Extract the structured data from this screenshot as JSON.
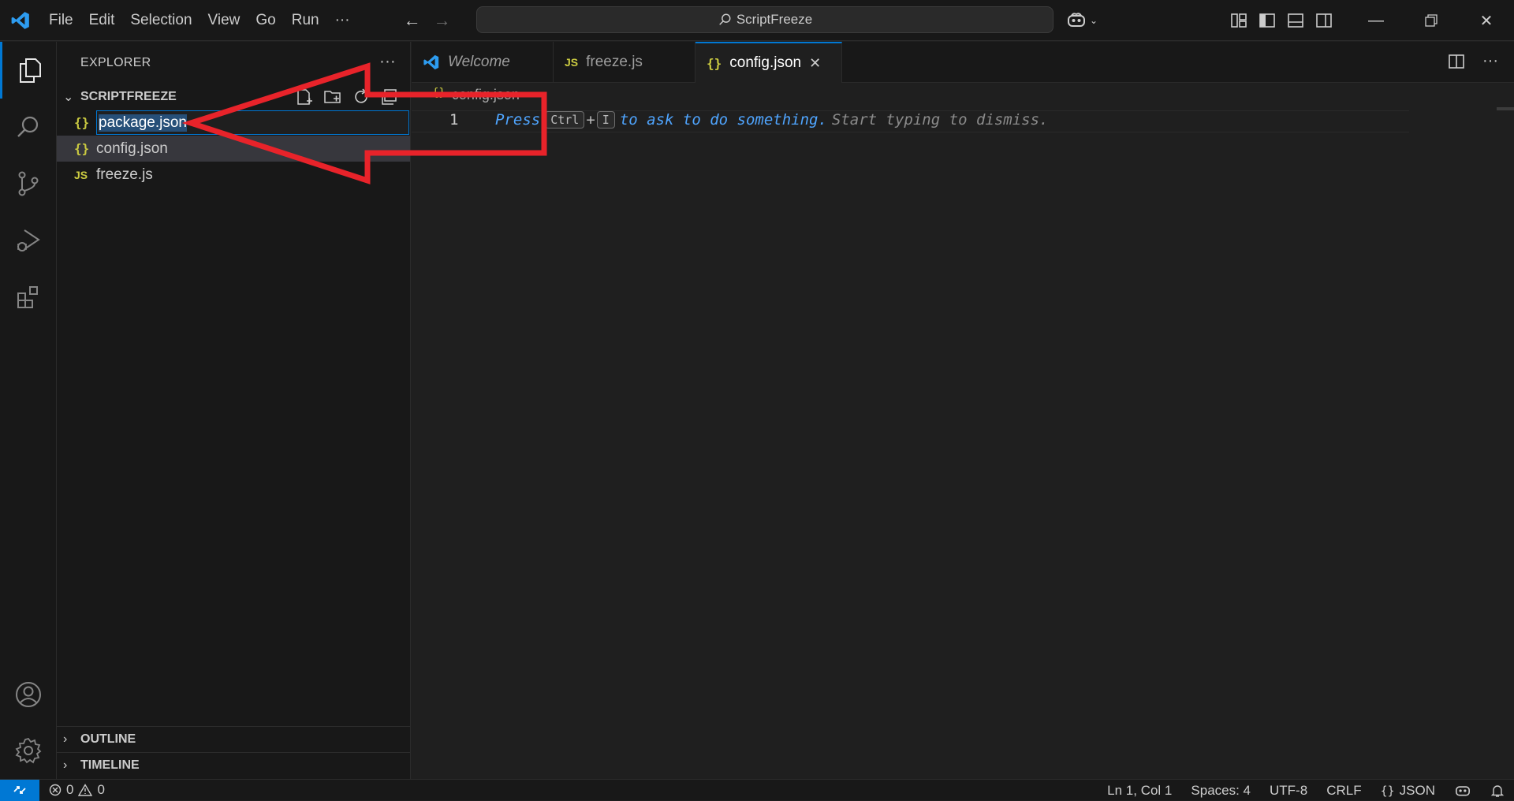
{
  "menu": [
    "File",
    "Edit",
    "Selection",
    "View",
    "Go",
    "Run"
  ],
  "menu_more": "···",
  "command_center": "ScriptFreeze",
  "sidebar": {
    "title": "EXPLORER",
    "more": "···",
    "folder": "SCRIPTFREEZE",
    "files": [
      {
        "name": "package.json",
        "icon": "{}",
        "type": "json",
        "state": "renaming"
      },
      {
        "name": "config.json",
        "icon": "{}",
        "type": "json",
        "state": "selected"
      },
      {
        "name": "freeze.js",
        "icon": "JS",
        "type": "js",
        "state": "normal"
      }
    ],
    "outline": "OUTLINE",
    "timeline": "TIMELINE"
  },
  "tabs": [
    {
      "label": "Welcome",
      "icon": "vscode-icon",
      "italic": true
    },
    {
      "label": "freeze.js",
      "icon": "JS",
      "italic": false
    },
    {
      "label": "config.json",
      "icon": "{}",
      "active": true,
      "close": "✕"
    }
  ],
  "breadcrumb": {
    "icon": "{}",
    "label": "config.json"
  },
  "editor": {
    "line_number": "1",
    "hint_press": "Press",
    "hint_key1": "Ctrl",
    "hint_plus": "+",
    "hint_key2": "I",
    "hint_ask": "to ask to do something.",
    "hint_dismiss": "Start typing to dismiss."
  },
  "statusbar": {
    "errors": "0",
    "warnings": "0",
    "position": "Ln 1, Col 1",
    "spaces": "Spaces: 4",
    "encoding": "UTF-8",
    "eol": "CRLF",
    "language": "JSON",
    "language_icon": "{}"
  },
  "colors": {
    "accent": "#0078d4",
    "annotation": "#e8232a",
    "json_icon": "#cbcb41"
  }
}
